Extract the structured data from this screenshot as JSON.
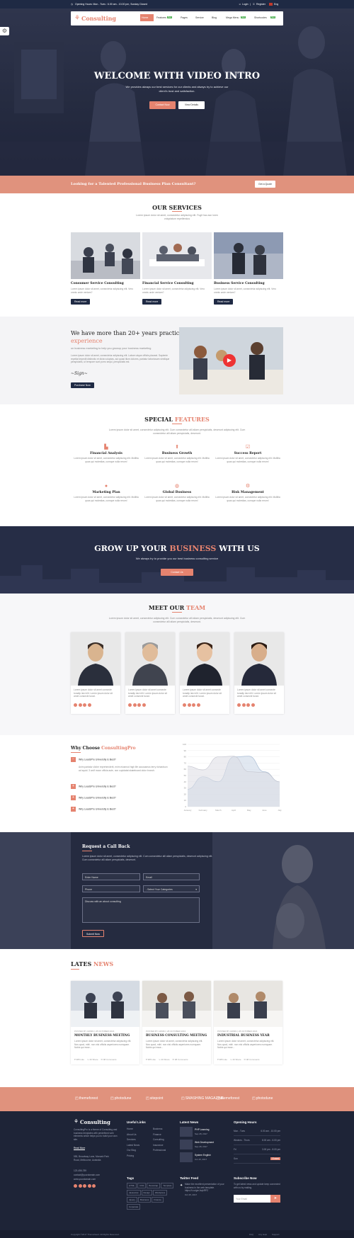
{
  "topbar": {
    "hours": "Opening Hours: Mon - Tues : 6.00 am - 10.00 pm, Sunday Closed",
    "login": "Login",
    "register": "Register",
    "lang": "Eng"
  },
  "nav": {
    "brand": "Consulting",
    "items": [
      {
        "label": "Home",
        "active": true
      },
      {
        "label": "Features",
        "badge": "New"
      },
      {
        "label": "Pages"
      },
      {
        "label": "Service"
      },
      {
        "label": "Blog"
      },
      {
        "label": "Mega Menu",
        "badge": "New"
      },
      {
        "label": "Shortcodes",
        "badge": "New"
      }
    ]
  },
  "hero": {
    "title": "WELCOME WITH VIDEO INTRO",
    "subtitle": "We provides always our best services for our clients and always try to achieve our client's trust and satisfaction.",
    "btn_contact": "Contact Now",
    "btn_details": "View Details"
  },
  "cta_bar": {
    "text": "Looking for a Talented Professional Business Plan Consultant?",
    "button": "Get a Quote"
  },
  "services": {
    "title": "OUR SERVICES",
    "intro": "Lorem ipsum dolor sit amet, consectetur adipiscing elit. Fugit hac asn loren voluptatum repellendus",
    "items": [
      {
        "title": "Consumer Service Consulting",
        "desc": "Lorem ipsum dolor sit amet, consectetur adipiscing elit. Vero omnis unde veniam?",
        "button": "Read more"
      },
      {
        "title": "Financial Service Consulting",
        "desc": "Lorem ipsum dolor sit amet, consectetur adipiscing elit. Vero omnis unde veniam?",
        "button": "Read more"
      },
      {
        "title": "Business Service Consulting",
        "desc": "Lorem ipsum dolor sit amet, consectetur adipiscing elit. Vero omnis unde veniam?",
        "button": "Read more"
      }
    ]
  },
  "experience": {
    "title_line1": "We have more than 20+ years practical",
    "title_line2": "experience",
    "sub": "on business marketing to help you growup your business marketing",
    "body": "Lorem ipsum dolor sit amet, consectetur adipiscing elit. Labore atque officiis placeat. Sapiente repellat impedit distinctio et dicta voluptas, aut quasi illum dolores, pariatur laboriosam similique perspiciatis, ut tempore sunt porro sequi, perspiciatis est.",
    "button": "Purchase Now"
  },
  "features": {
    "title_a": "SPECIAL",
    "title_b": "FEATURES",
    "intro": "Lorem ipsum dolor sit amet, consectetur adipiscing elit. Cum consectetur alli aliam perspiciatis, deserunt adipiscing elit. Cum consectetur alli aliam perspiciatis, deserunt.",
    "items": [
      {
        "title": "Financial Analysis",
        "icon": "chart-icon",
        "desc": "Lorem ipsum dolor sit amet, consectetur adipiscing elit. Mollitia quas qui molestias, cumque nulla rerum!"
      },
      {
        "title": "Business Growth",
        "icon": "growth-icon",
        "desc": "Lorem ipsum dolor sit amet, consectetur adipiscing elit. Mollitia quas qui molestias, cumque nulla rerum!"
      },
      {
        "title": "Success Report",
        "icon": "report-icon",
        "desc": "Lorem ipsum dolor sit amet, consectetur adipiscing elit. Mollitia quas qui molestias, cumque nulla rerum!"
      },
      {
        "title": "Marketing Plan",
        "icon": "coins-icon",
        "desc": "Lorem ipsum dolor sit amet, consectetur adipiscing elit. Mollitia quas qui molestias, cumque nulla rerum!"
      },
      {
        "title": "Global Business",
        "icon": "globe-icon",
        "desc": "Lorem ipsum dolor sit amet, consectetur adipiscing elit. Mollitia quas qui molestias, cumque nulla rerum!"
      },
      {
        "title": "Risk Management",
        "icon": "risk-icon",
        "desc": "Lorem ipsum dolor sit amet, consectetur adipiscing elit. Mollitia quas qui molestias, cumque nulla rerum!"
      }
    ]
  },
  "growup": {
    "title_a": "GROW UP YOUR",
    "title_b": "BUSINESS",
    "title_c": "WITH US",
    "sub": "We always try to provide you our best business consulting service",
    "button": "Contact Us"
  },
  "team": {
    "title_a": "MEET OUR",
    "title_b": "TEAM",
    "intro": "Lorem ipsum dolor sit amet, consectetur adipiscing elit. Cum consectetur alli aliam perspiciatis, deserunt adipiscing elit. Cum consectetur alli aliam perspiciatis, deserunt.",
    "bio": "Lorem ipsum dolor sit amet consecte turadip isici elit. Lorem ipsum dolor sit amet consecte turad."
  },
  "why": {
    "title_a": "Why Choose",
    "title_b": "ConsultingPro",
    "items": [
      "Why LeadsPro University is Best?",
      "Why LeadsPro University is Best?",
      "Why LeadsPro University is Best?",
      "Why LeadsPro University is Best?",
      "Why LeadsPro University is Best?"
    ],
    "answer": "Anim pariatur cliche reprehenderit, enim eiusmod high life accusamus terry richardson ad squid. 3 wolf moon officia aute, non cupidatat skateboard dolor brunch."
  },
  "chart_data": {
    "type": "line",
    "categories": [
      "January",
      "February",
      "March",
      "April",
      "May",
      "June",
      "July"
    ],
    "yticks": [
      0,
      10,
      20,
      30,
      40,
      50,
      60,
      70,
      80,
      90,
      100
    ],
    "ylim": [
      0,
      100
    ],
    "series": [
      {
        "values": [
          28,
          48,
          40,
          80,
          81,
          56,
          40
        ],
        "fill": "#c8d6e6"
      },
      {
        "values": [
          65,
          59,
          80,
          81,
          56,
          55,
          40
        ],
        "fill": "#dcdde3"
      }
    ]
  },
  "callback": {
    "title": "Request a Call Back",
    "desc": "Lorem ipsum dolor sit amet, consectetur adipiscing elit. Cum consectetur alli aliam perspiciatis, deserunt adipiscing elit. Cum consectetur alli aliam perspiciatis, deserunt.",
    "name": "Enter Name",
    "email": "Email",
    "phone": "Phone",
    "select": "- Select Your Categories",
    "message": "Discuss with an about consulting",
    "submit": "Submit Now"
  },
  "news": {
    "title_a": "LATES",
    "title_b": "NEWS",
    "items": [
      {
        "meta": "POSTED BY ADMIN | 28 OCTOBER 2016",
        "title": "MONTHLY BUSINESS MEETING",
        "desc": "Lorem ipsum dolor sit amet, consectetur adipiscing elit. Nos quod, mihi. non nisi officiis asperiores numquam. Nobis qui esse...",
        "likes": "985 Like",
        "shares": "40 Share",
        "comments": "98 Comments"
      },
      {
        "meta": "POSTED BY ADMIN | 28 OCTOBER 2016",
        "title": "BUSINESS CONSULTING MEETING",
        "desc": "Lorem ipsum dolor sit amet, consectetur adipiscing elit. Nos quod, mihi. non nisi officiis asperiores numquam. Nobis qui esse...",
        "likes": "985 Like",
        "shares": "40 Share",
        "comments": "98 Comments"
      },
      {
        "meta": "POSTED BY ADMIN | 28 OCTOBER 2016",
        "title": "INDUSTRIAL BUSINESS YEAR",
        "desc": "Lorem ipsum dolor sit amet, consectetur adipiscing elit. Nos quod, mihi. non nisi officiis asperiores numquam. Nobis qui esse...",
        "likes": "985 Like",
        "shares": "40 Share",
        "comments": "98 Comments"
      }
    ]
  },
  "partners": [
    "themeforest",
    "photodune",
    "sitepoint",
    "SMASHING MAGAZINE",
    "themeforest",
    "photodune"
  ],
  "footer": {
    "brand": "Consulting",
    "about": "ConsultingPro is a theme of Consulting and business templates with predefined web elements which helps you to build your own site.",
    "read_more": "Read More",
    "address": "555, Broadway Lane, Monash Park Road, Melbourne, Australia",
    "phone": "123-456-789",
    "email": "contact@yourdomain.com",
    "web": "www.yourdomain.com",
    "links_title": "Useful Links",
    "links_a": [
      "Home",
      "About Us",
      "Services",
      "Latest News",
      "Our Blog",
      "Pricing"
    ],
    "links_b": [
      "Business",
      "Finance",
      "Consulting",
      "Insurance",
      "Professional"
    ],
    "news_title": "Latest News",
    "news": [
      {
        "title": "PHP Learning",
        "date": "Sep 28, 2017"
      },
      {
        "title": "Web Development",
        "date": "Sep 28, 2017"
      },
      {
        "title": "System English",
        "date": "Oct 15, 2017"
      }
    ],
    "hours_title": "Opening Hours",
    "hours": [
      {
        "day": "Mon - Tues",
        "time": "6.00 am - 10.00 pm"
      },
      {
        "day": "Wednes - Thurs",
        "time": "8.00 am - 6.00 pm"
      },
      {
        "day": "Fri",
        "time": "3.00 pm - 8.00 pm"
      },
      {
        "day": "Sun",
        "time": "Closed"
      }
    ],
    "tags_title": "Tags",
    "tags": [
      "HTML",
      "CSS",
      "Bootstrap",
      "Template",
      "Javascript",
      "Design",
      "Wordpress",
      "Jquery",
      "Business",
      "Finance",
      "Corporate"
    ],
    "twitter_title": "Twitter Feed",
    "tweet": "Make the excellent presentation of your business in the web template. https://t.co/grnJxqkRPZ",
    "tweet_date": "Oct 15, 2017",
    "subscribe_title": "Subscribe Now",
    "subscribe_text": "To get latest news and update keep connected with us by mailing.",
    "email_placeholder": "Your Email",
    "copyright": "Copyright ©2017 ThemeNeed. All Rights Reserved.",
    "bottom_links": [
      "FAQ",
      "Any Help",
      "Support"
    ]
  }
}
